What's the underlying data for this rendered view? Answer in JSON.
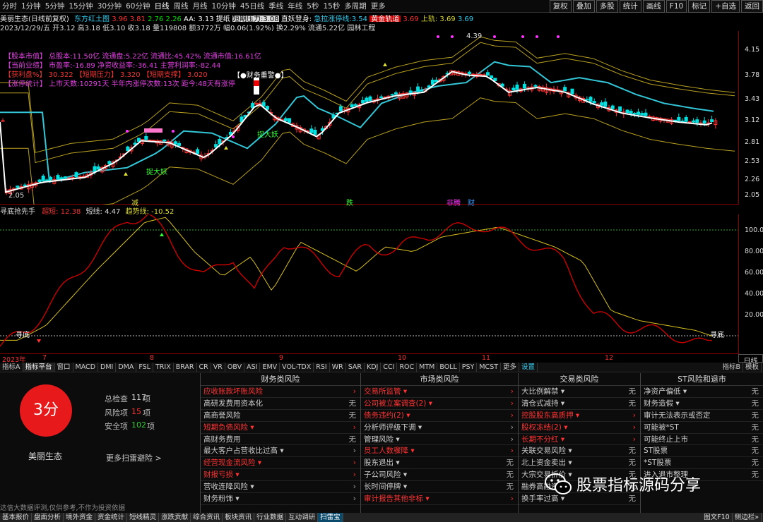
{
  "periods": [
    "分时",
    "1分钟",
    "5分钟",
    "15分钟",
    "30分钟",
    "60分钟",
    "日线",
    "周线",
    "月线",
    "10分钟",
    "45日线",
    "季线",
    "年线",
    "5秒",
    "15秒",
    "多周期",
    "更多"
  ],
  "active_period": "日线",
  "right_buttons": [
    "复权",
    "叠加",
    "多股",
    "统计",
    "画线",
    "F10",
    "标记",
    "+自选",
    "返回"
  ],
  "stock_info": {
    "name": "美丽生态(日线前复权)",
    "indicator": "东方红土图",
    "v1": "3.96",
    "v2": "3.81",
    "v3": "2.76",
    "v4": "2.26",
    "aa": "AA: 3.13",
    "tip": "提纸",
    "press_label": "短期压力:3.08",
    "sky_label": "直妖登身:",
    "limit_label": "急拉涨停线:3.54",
    "gold_label": "黄金轨道",
    "gold_val": "3.69",
    "up_label": "上轨:",
    "up_val": "3.69",
    "up_val2": "3.69"
  },
  "quote": "2023/12/29/五 开3.12 高3.18 低3.10 收3.18 量119808 额3772万 幅0.06(1.92%) 换2.29% 流通5.22亿 园林工程",
  "overlay_lines": [
    {
      "text": "【股本市值】 总股本:11.50亿 流通盘:5.22亿 流通比:45.42% 流通市值:16.61亿",
      "color": "#e040e0"
    },
    {
      "text": "【当前业绩】 市盈率:-16.89 净资收益率:-36.41 主营利润率:-82.44",
      "color": "#e040e0"
    },
    {
      "text": "【获利盘%】 30.322 【短期压力】 3.320 【短期支撑】 3.020",
      "color": "#e33"
    },
    {
      "text": "【涨停统计】 上市天数:10291天 半年内涨停次数:13次 距今:48天有涨停",
      "color": "#e040e0"
    }
  ],
  "chart_labels": {
    "finance_warn": "【●财务重警●】",
    "buy_a": "捉大妖",
    "buy_b": "捉大妖",
    "high": "4.39",
    "low": "2.05",
    "jian": "减",
    "die": "跌",
    "feiteng": "非腾",
    "cai": "财"
  },
  "price_ticks": [
    "4.15",
    "3.78",
    "3.43",
    "3.12",
    "2.81",
    "2.53",
    "2.26",
    "2.05"
  ],
  "indicator_head": {
    "name": "寻底抢先手",
    "l1": "超短: 12.38",
    "l2": "短线: 4.47",
    "l3": "趋势线: -10.52"
  },
  "ind_ticks": [
    "100.0",
    "80.00",
    "60.00",
    "40.00",
    "20.00"
  ],
  "ind_labels": {
    "xundi": "寻底",
    "xundi_r": "寻底"
  },
  "date_labels": {
    "y": "2023年",
    "m7": "7",
    "m8": "8",
    "m9": "9",
    "m10": "10",
    "m11": "11",
    "m12": "12"
  },
  "day_line": "日线",
  "tabs": [
    "指标A",
    "指标平台",
    "窗口",
    "MACD",
    "DMI",
    "DMA",
    "FSL",
    "TRIX",
    "BRAR",
    "CR",
    "VR",
    "OBV",
    "ASI",
    "EMV",
    "VOL-TDX",
    "RSI",
    "WR",
    "SAR",
    "KDJ",
    "CCI",
    "ROC",
    "MTM",
    "BOLL",
    "PSY",
    "MCST",
    "更多",
    "设置"
  ],
  "tabs_right": [
    "指标B",
    "模板"
  ],
  "score": "3分",
  "stock_name": "美丽生态",
  "stats": [
    {
      "label": "总检查",
      "value": "117",
      "unit": "项"
    },
    {
      "label": "风险项",
      "value": "15",
      "unit": "项"
    },
    {
      "label": "安全项",
      "value": "102",
      "unit": "项"
    }
  ],
  "more_scan": "更多扫雷避险 >",
  "columns": [
    {
      "title": "财务类风险",
      "rows": [
        [
          "应收账款坏账风险",
          "›",
          1
        ],
        [
          "高研发费用资本化",
          "无",
          0
        ],
        [
          "高商誉风险",
          "无",
          0
        ],
        [
          "短期负债风险 ▾",
          "›",
          1
        ],
        [
          "高财务费用",
          "无",
          0
        ],
        [
          "最大客户占营收比过高 ▾",
          "›",
          0
        ],
        [
          "经营现金流风险 ▾",
          "›",
          1
        ],
        [
          "财报亏损 ▾",
          "›",
          1
        ],
        [
          "营收连降风险 ▾",
          "›",
          0
        ],
        [
          "财务粉饰 ▾",
          "›",
          0
        ]
      ]
    },
    {
      "title": "市场类风险",
      "rows": [
        [
          "交易所监管 ▾",
          "›",
          1
        ],
        [
          "公司被立案调查(2) ▾",
          "›",
          1
        ],
        [
          "债务违约(2) ▾",
          "›",
          1
        ],
        [
          "分析师评级下调 ▾",
          "›",
          0
        ],
        [
          "管理风险 ▾",
          "›",
          0
        ],
        [
          "员工人数骤降 ▾",
          "›",
          1
        ],
        [
          "股东退出 ▾",
          "无",
          0
        ],
        [
          "子公司风险 ▾",
          "无",
          0
        ],
        [
          "长时间停牌 ▾",
          "无",
          0
        ],
        [
          "审计报告其他非标 ▾",
          "›",
          1
        ]
      ]
    },
    {
      "title": "交易类风险",
      "rows": [
        [
          "大比例解禁 ▾",
          "无",
          0
        ],
        [
          "清仓式减持 ▾",
          "无",
          0
        ],
        [
          "控股股东高质押 ▾",
          "›",
          1
        ],
        [
          "股权冻结(2) ▾",
          "›",
          1
        ],
        [
          "长期不分红 ▾",
          "›",
          1
        ],
        [
          "关联交易风险 ▾",
          "无",
          0
        ],
        [
          "北上资金卖出 ▾",
          "无",
          0
        ],
        [
          "大宗交易折价 ▾",
          "无",
          0
        ],
        [
          "融券高融资 ▾",
          "无",
          0
        ],
        [
          "换手率过高 ▾",
          "无",
          0
        ]
      ]
    },
    {
      "title": "ST风险和退市",
      "rows": [
        [
          "净资产偏低 ▾",
          "无",
          0
        ],
        [
          "财务造假 ▾",
          "无",
          0
        ],
        [
          "审计无法表示或否定",
          "无",
          0
        ],
        [
          "可能被*ST",
          "无",
          0
        ],
        [
          "可能终止上市",
          "无",
          0
        ],
        [
          "ST股票",
          "无",
          0
        ],
        [
          "*ST股票",
          "无",
          0
        ],
        [
          "进入退市整理",
          "无",
          0
        ]
      ]
    }
  ],
  "disclaimer": "达信大数据评测,仅供参考,不作为投资依据",
  "bottom_tabs": [
    "基本报价",
    "盘面分析",
    "境外资金",
    "资金统计",
    "短线精灵",
    "涨跌贡献",
    "综合资讯",
    "板块资讯",
    "行业数据",
    "互动调研",
    "扫雷宝"
  ],
  "bottom_active": "扫雷宝",
  "bottom_right": [
    "图文F10",
    "侧边栏»"
  ],
  "watermark": "股票指标源码分享",
  "colors": {
    "up": "#ff3333",
    "down": "#00e0e0",
    "cyan_line": "#33c6d6",
    "yellow": "#d8c020",
    "risk_red": "#ff3333",
    "score_bg": "#e8191b"
  }
}
